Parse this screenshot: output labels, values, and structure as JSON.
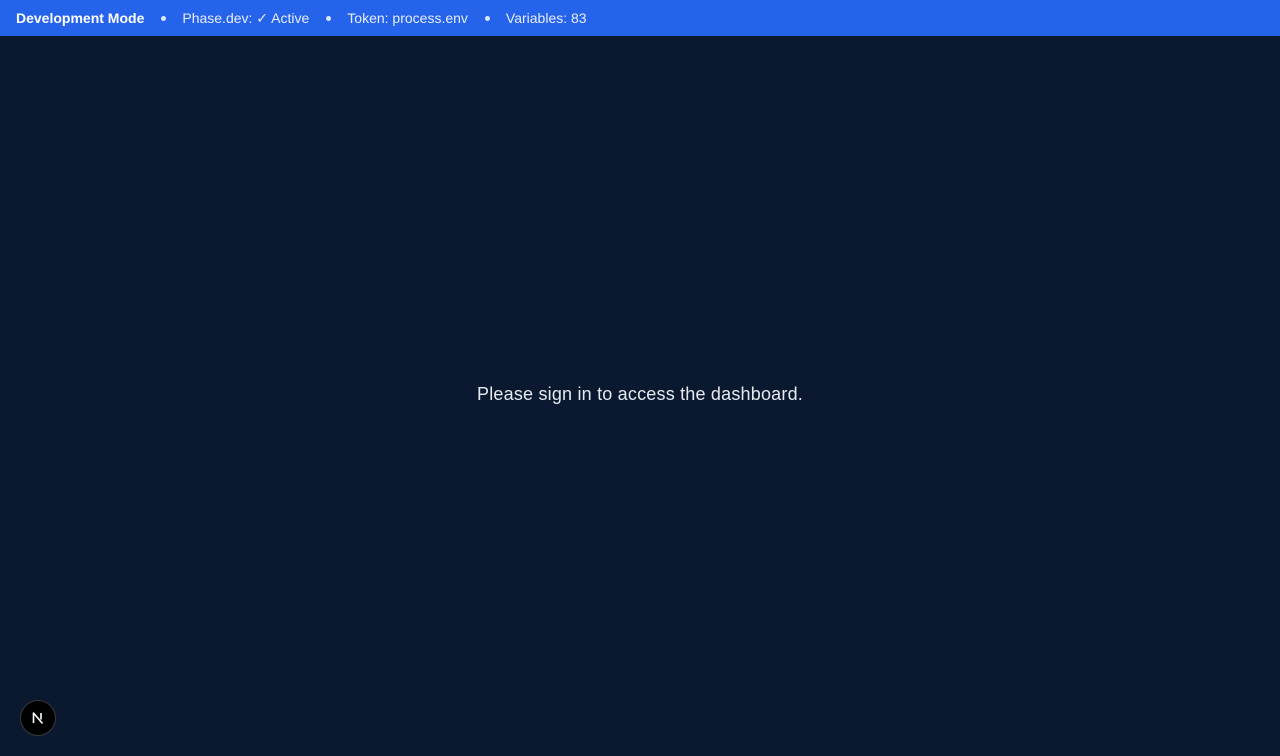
{
  "dev_bar": {
    "mode_label": "Development Mode",
    "phase_label": "Phase.dev: ✓ Active",
    "token_label": "Token: process.env",
    "variables_label": "Variables: 83",
    "background_color": "#2563eb"
  },
  "main": {
    "message": "Please sign in to access the dashboard.",
    "background_color": "#0b1930"
  },
  "next_badge": {
    "icon": "nextjs-logo-icon"
  }
}
